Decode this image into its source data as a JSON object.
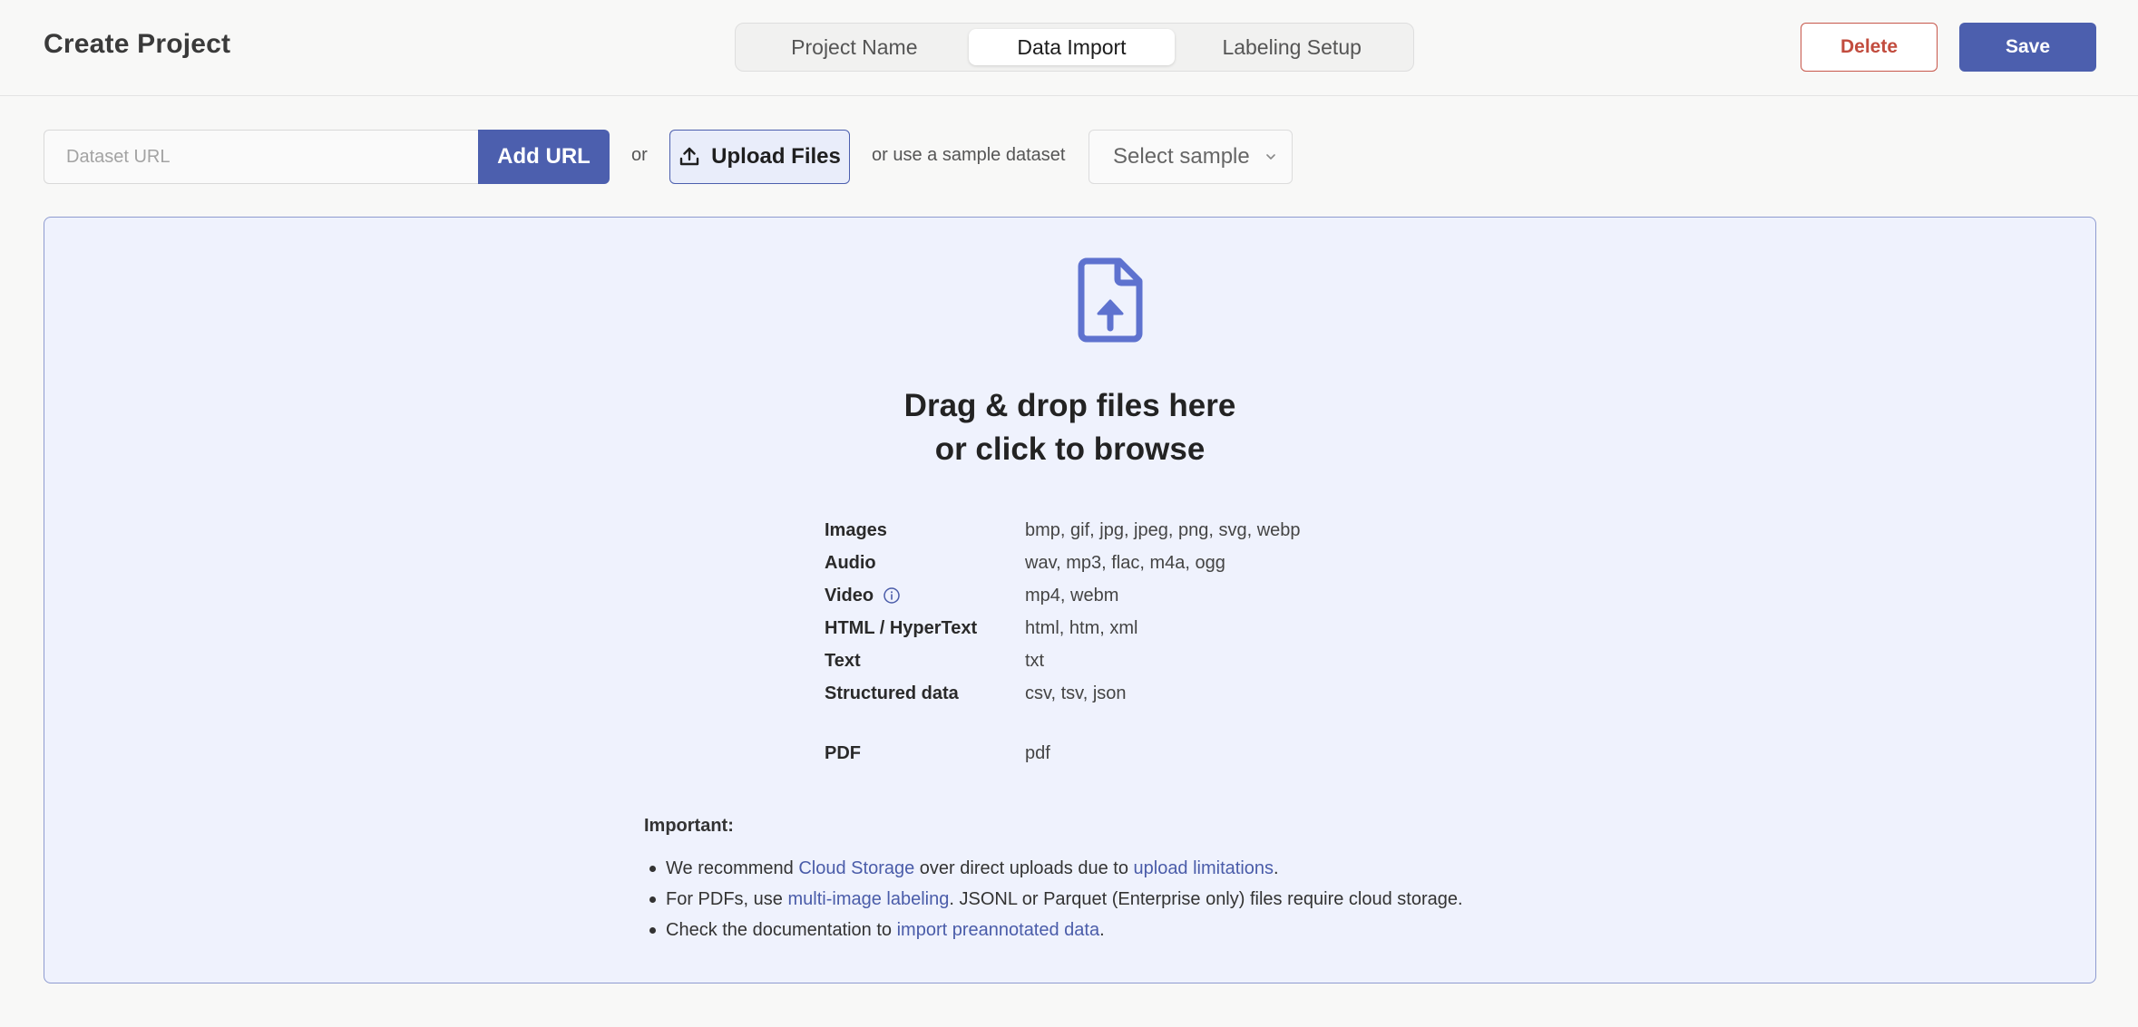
{
  "header": {
    "title": "Create Project",
    "steps": [
      "Project Name",
      "Data Import",
      "Labeling Setup"
    ],
    "active_step": "Data Import",
    "delete_label": "Delete",
    "save_label": "Save"
  },
  "toolbar": {
    "url_placeholder": "Dataset URL",
    "url_value": "",
    "add_url_label": "Add URL",
    "or_label": "or",
    "upload_label": "Upload Files",
    "sample_text": "or use a sample dataset",
    "sample_select_value": "Select sample"
  },
  "dropzone": {
    "title_line1": "Drag & drop files here",
    "title_line2": "or click to browse",
    "file_types": [
      {
        "name": "Images",
        "extensions": "bmp, gif, jpg, jpeg, png, svg, webp"
      },
      {
        "name": "Audio",
        "extensions": "wav, mp3, flac, m4a, ogg"
      },
      {
        "name": "Video",
        "extensions": "mp4, webm"
      },
      {
        "name": "HTML / HyperText",
        "extensions": "html, htm, xml"
      },
      {
        "name": "Text",
        "extensions": "txt"
      },
      {
        "name": "Structured data",
        "extensions": "csv, tsv, json"
      },
      {
        "name": "PDF",
        "extensions": "pdf"
      }
    ],
    "important": {
      "title": "Important:",
      "item1": {
        "pre": "We recommend ",
        "link1": "Cloud Storage",
        "mid": " over direct uploads due to ",
        "link2": "upload limitations",
        "post": "."
      },
      "item2": {
        "pre": "For PDFs, use ",
        "link": "multi-image labeling",
        "post": ". JSONL or Parquet (Enterprise only) files require cloud storage."
      },
      "item3": {
        "pre": "Check the documentation to ",
        "link": "import preannotated data",
        "post": "."
      }
    }
  },
  "colors": {
    "primary": "#4c5fae",
    "danger": "#c24c3e",
    "dropzone_bg": "#eff2fd",
    "dropzone_border": "#8e9bd0",
    "link": "#4a5ca9",
    "page_bg": "#f8f8f7"
  },
  "icons": {
    "upload": "upload-icon",
    "file_upload": "file-upload-icon",
    "info": "info-icon",
    "chevron": "chevron-down-icon"
  }
}
